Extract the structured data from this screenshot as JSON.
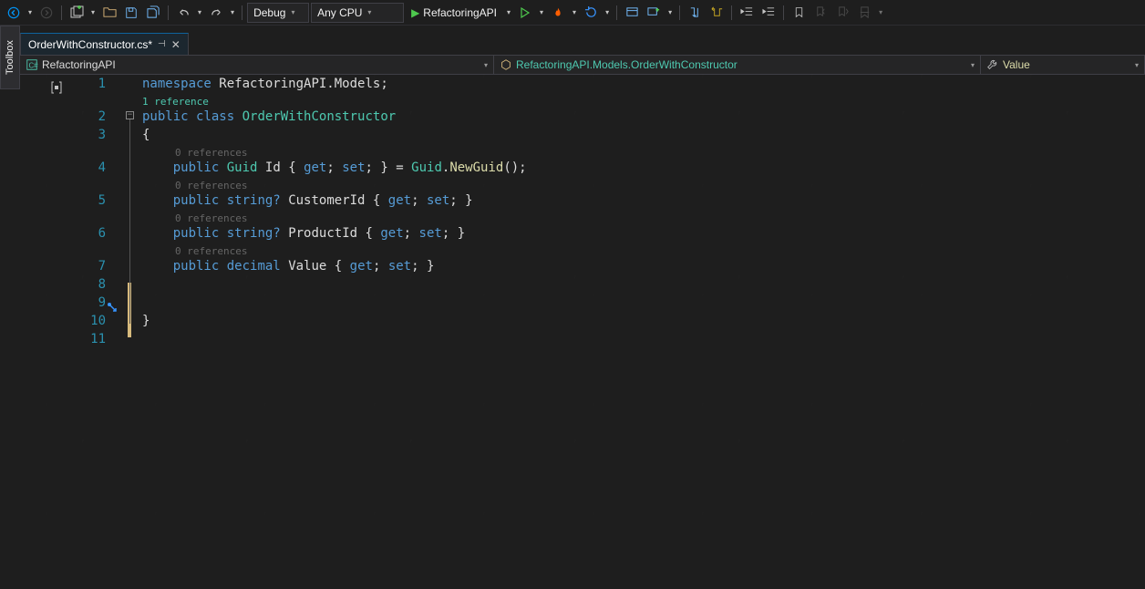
{
  "toolbar": {
    "config_label": "Debug",
    "platform_label": "Any CPU",
    "start_label": "RefactoringAPI"
  },
  "toolbox_tab": "Toolbox",
  "tab": {
    "title": "OrderWithConstructor.cs*"
  },
  "nav": {
    "project": "RefactoringAPI",
    "class": "RefactoringAPI.Models.OrderWithConstructor",
    "member": "Value"
  },
  "codelens": {
    "class": "1 reference",
    "id": "0 references",
    "customer": "0 references",
    "product": "0 references",
    "value": "0 references"
  },
  "code": {
    "l1_namespace": "namespace",
    "l1_ns": "RefactoringAPI.Models",
    "l2_public": "public",
    "l2_class": "class",
    "l2_name": "OrderWithConstructor",
    "brace_open": "{",
    "brace_close": "}",
    "l4": {
      "public": "public",
      "type": "Guid",
      "name": "Id",
      "get": "get",
      "set": "set",
      "eq": "=",
      "gtype": "Guid",
      "method": "NewGuid"
    },
    "l5": {
      "public": "public",
      "type": "string?",
      "name": "CustomerId",
      "get": "get",
      "set": "set"
    },
    "l6": {
      "public": "public",
      "type": "string?",
      "name": "ProductId",
      "get": "get",
      "set": "set"
    },
    "l7": {
      "public": "public",
      "type": "decimal",
      "name": "Value",
      "get": "get",
      "set": "set"
    }
  },
  "line_numbers": [
    "1",
    "2",
    "3",
    "4",
    "5",
    "6",
    "7",
    "8",
    "9",
    "10",
    "11"
  ]
}
